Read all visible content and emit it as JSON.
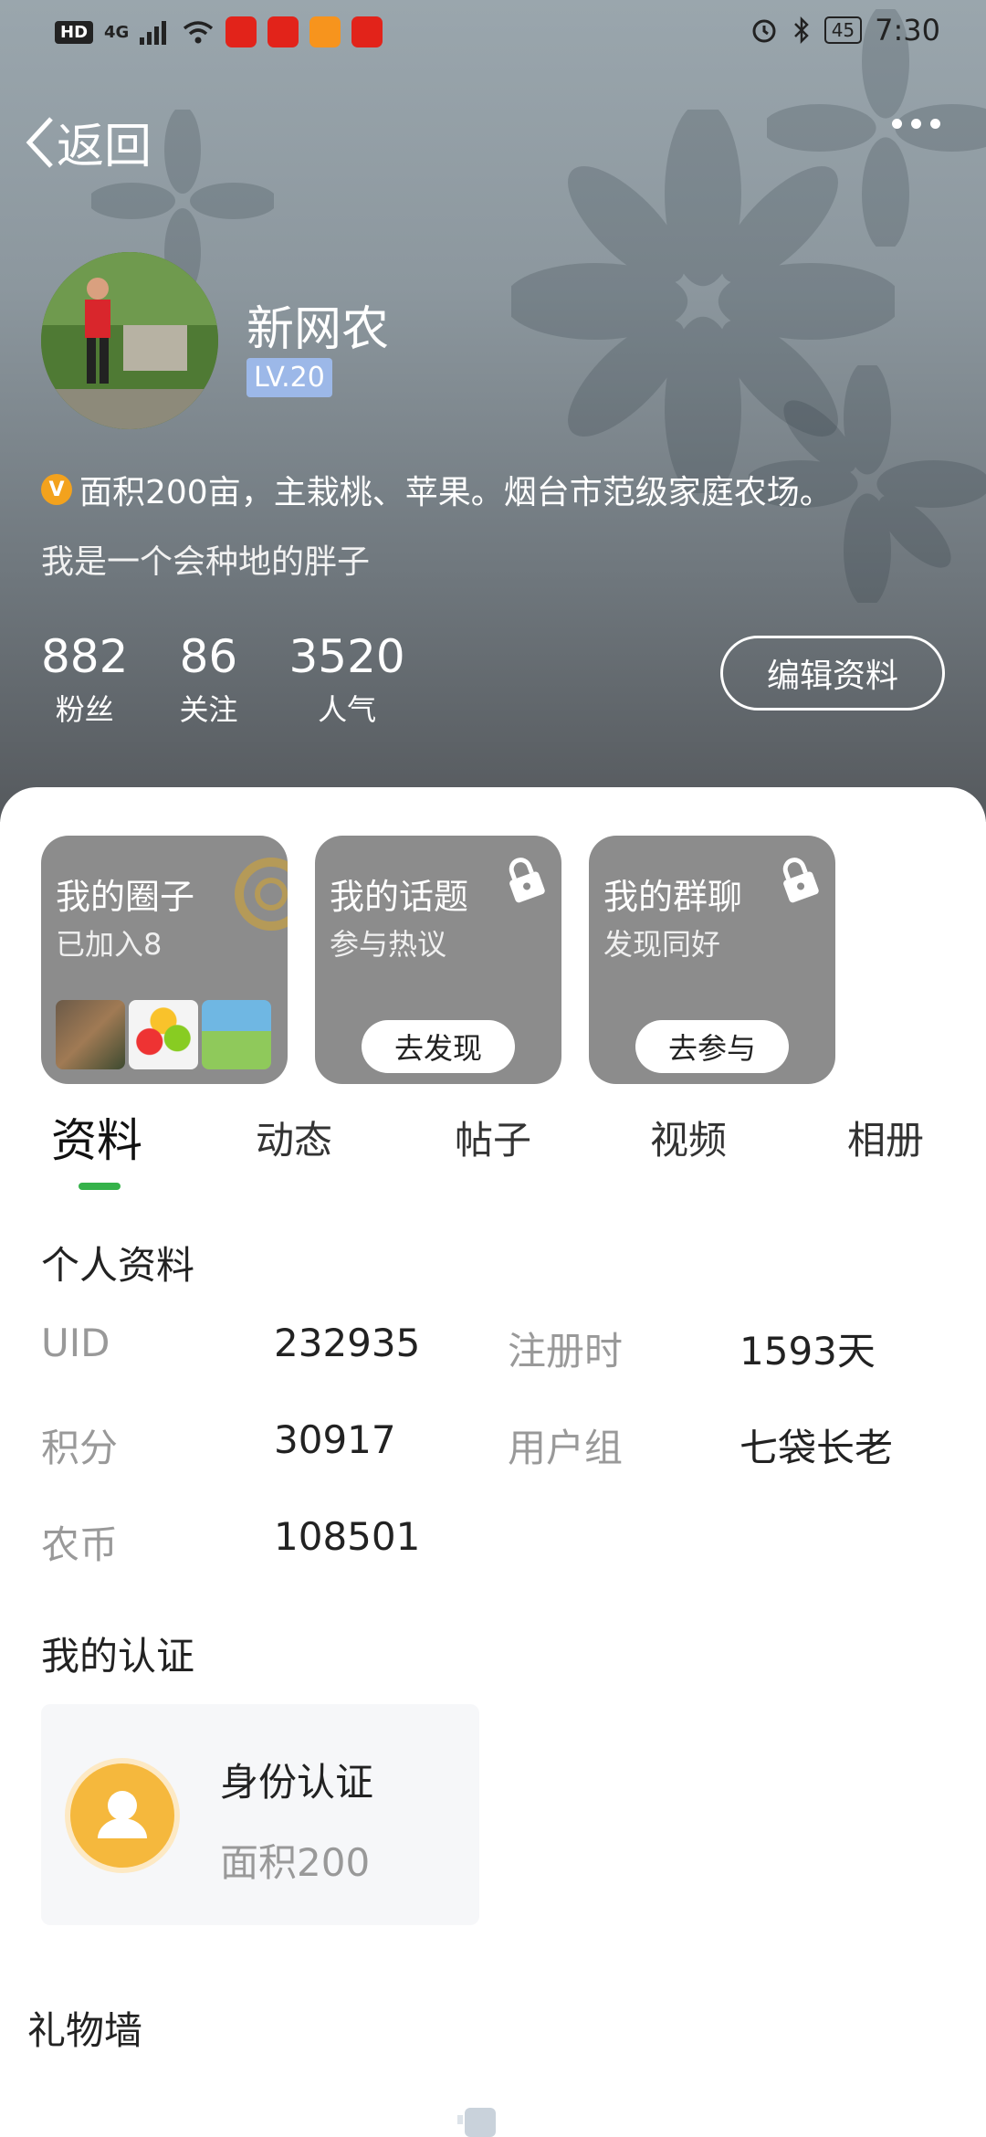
{
  "status_bar": {
    "hd": "HD",
    "network": "4G",
    "battery": "45",
    "time": "7:30"
  },
  "nav": {
    "back_label": "返回"
  },
  "profile": {
    "name": "新网农",
    "level": "LV.20",
    "bio_line1": "面积200亩，主栽桃、苹果。烟台市范级家庭农场。",
    "bio_line2": "我是一个会种地的胖子",
    "stats": [
      {
        "num": "882",
        "label": "粉丝"
      },
      {
        "num": "86",
        "label": "关注"
      },
      {
        "num": "3520",
        "label": "人气"
      }
    ],
    "edit_label": "编辑资料"
  },
  "cards": [
    {
      "title": "我的圈子",
      "sub": "已加入8"
    },
    {
      "title": "我的话题",
      "sub": "参与热议",
      "button": "去发现"
    },
    {
      "title": "我的群聊",
      "sub": "发现同好",
      "button": "去参与"
    }
  ],
  "tabs": [
    "资料",
    "动态",
    "帖子",
    "视频",
    "相册"
  ],
  "personal": {
    "title": "个人资料",
    "uid_label": "UID",
    "uid": "232935",
    "reg_label": "注册时",
    "reg": "1593天",
    "points_label": "积分",
    "points": "30917",
    "group_label": "用户组",
    "group": "七袋长老",
    "coin_label": "农币",
    "coin": "108501"
  },
  "cert": {
    "title": "我的认证",
    "card_title": "身份认证",
    "card_sub": "面积200"
  },
  "gift": {
    "title": "礼物墙"
  }
}
